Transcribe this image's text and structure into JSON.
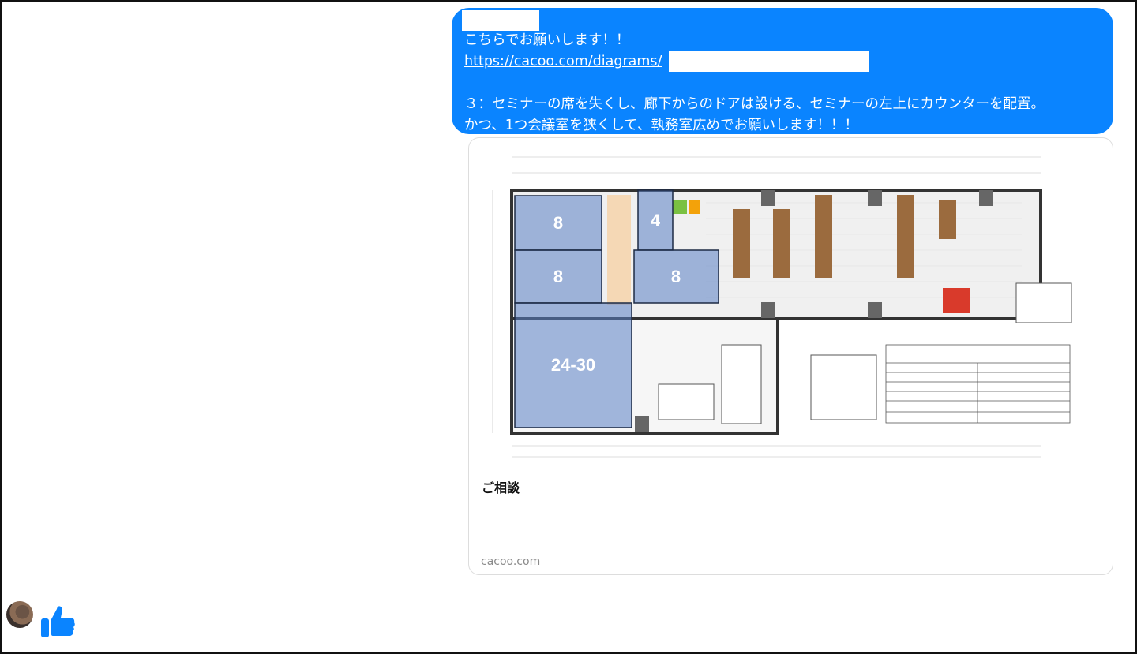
{
  "message": {
    "line1": "こちらでお願いします！！",
    "link": "https://cacoo.com/diagrams/",
    "line3": "３：セミナーの席を失くし、廊下からのドアは設ける、セミナーの左上にカウンターを配置。",
    "line4": "かつ、1つ会議室を狭くして、執務室広めでお願いします！！！"
  },
  "preview": {
    "title": "ご相談",
    "domain": "cacoo.com",
    "rooms": [
      "8",
      "8",
      "24-30",
      "4",
      "8"
    ]
  },
  "colors": {
    "bubble": "#0a84ff",
    "room_overlay": "#5a7fc4"
  }
}
